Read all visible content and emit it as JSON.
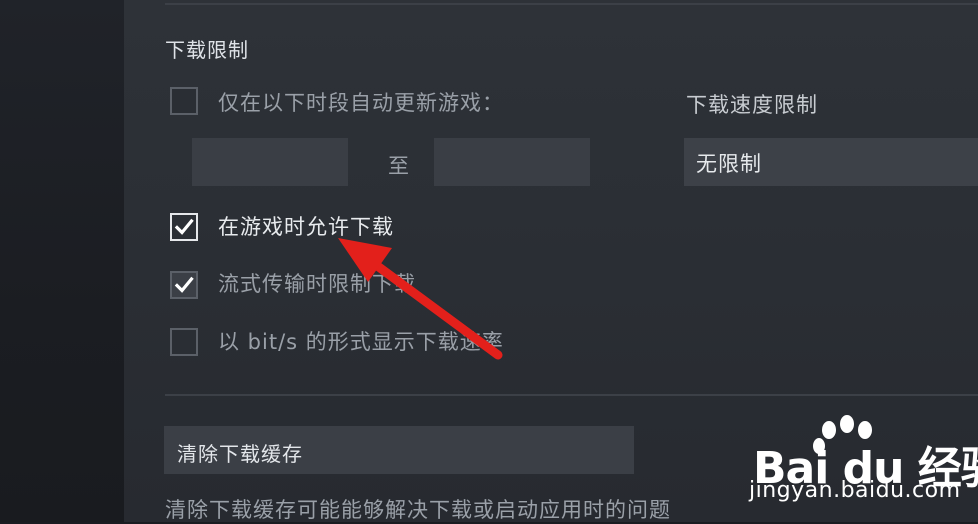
{
  "section": {
    "title": "下载限制"
  },
  "options": {
    "auto_update_window": {
      "label": "仅在以下时段自动更新游戏：",
      "checked": false
    },
    "to_label": "至",
    "allow_while_playing": {
      "label": "在游戏时允许下载",
      "checked": true
    },
    "throttle_streaming": {
      "label": "流式传输时限制下载",
      "checked": true
    },
    "bits_display": {
      "label": "以 bit/s 的形式显示下载速率",
      "checked": false
    }
  },
  "speed_limit": {
    "label": "下载速度限制",
    "value": "无限制"
  },
  "cache": {
    "button_label": "清除下载缓存",
    "description": "清除下载缓存可能能够解决下载或启动应用时的问题"
  },
  "watermark": {
    "brand": "Bai du 经验",
    "url": "jingyan.baidu.com"
  },
  "colors": {
    "annotation_arrow": "#e3201b",
    "panel_bg": "#2b2f35",
    "sidebar_bg": "#1d1f24"
  }
}
